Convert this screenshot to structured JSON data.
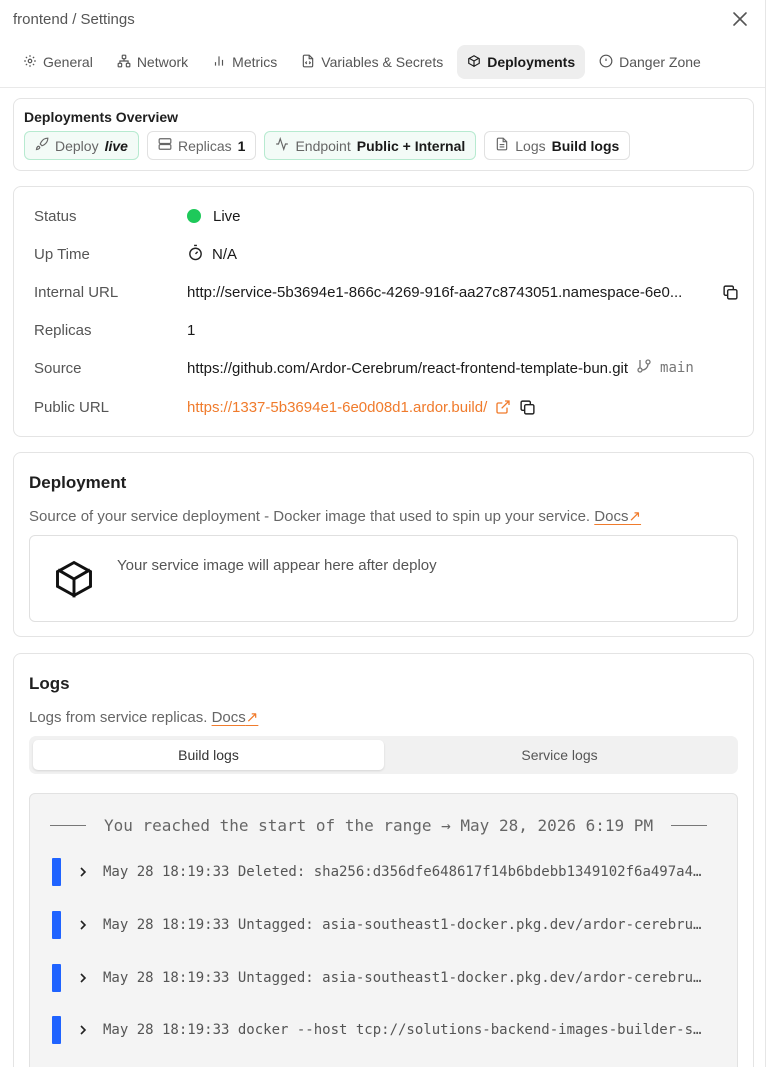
{
  "header": {
    "breadcrumb": "frontend / Settings"
  },
  "tabs": [
    {
      "label": "General",
      "icon": "gear-icon"
    },
    {
      "label": "Network",
      "icon": "network-icon"
    },
    {
      "label": "Metrics",
      "icon": "bar-chart-icon"
    },
    {
      "label": "Variables & Secrets",
      "icon": "file-code-icon"
    },
    {
      "label": "Deployments",
      "icon": "package-icon",
      "active": true
    },
    {
      "label": "Danger Zone",
      "icon": "alert-circle-icon"
    }
  ],
  "overview": {
    "title": "Deployments Overview",
    "pills": [
      {
        "label": "Deploy",
        "value": "live",
        "icon": "rocket-icon"
      },
      {
        "label": "Replicas",
        "value": "1",
        "icon": "server-icon"
      },
      {
        "label": "Endpoint",
        "value": "Public + Internal",
        "icon": "activity-icon"
      },
      {
        "label": "Logs",
        "value": "Build logs",
        "icon": "file-text-icon"
      }
    ]
  },
  "info": {
    "status_label": "Status",
    "status_value": "Live",
    "uptime_label": "Up Time",
    "uptime_value": "N/A",
    "internal_label": "Internal URL",
    "internal_value": "http://service-5b3694e1-866c-4269-916f-aa27c8743051.namespace-6e0...",
    "replicas_label": "Replicas",
    "replicas_value": "1",
    "source_label": "Source",
    "source_value": "https://github.com/Ardor-Cerebrum/react-frontend-template-bun.git",
    "source_branch": "main",
    "public_label": "Public URL",
    "public_value": "https://1337-5b3694e1-6e0d08d1.ardor.build/"
  },
  "deployment": {
    "title": "Deployment",
    "description": "Source of your service deployment - Docker image that used to spin up your service.",
    "docs": "Docs",
    "docs_arrow": "↗",
    "placeholder": "Your service image will appear here after deploy"
  },
  "logs": {
    "title": "Logs",
    "description": "Logs from service replicas.",
    "docs": "Docs",
    "docs_arrow": "↗",
    "tab_build": "Build logs",
    "tab_service": "Service logs",
    "range_text": "You reached the start of the range → May 28, 2026 6:19 PM",
    "rows": [
      "May 28 18:19:33 Deleted: sha256:d356dfe648617f14b6bdebb1349102f6a497a4…",
      "May 28 18:19:33 Untagged: asia-southeast1-docker.pkg.dev/ardor-cerebru…",
      "May 28 18:19:33 Untagged: asia-southeast1-docker.pkg.dev/ardor-cerebru…",
      "May 28 18:19:33 docker --host tcp://solutions-backend-images-builder-s…"
    ]
  },
  "colors": {
    "accent": "#f07b2c",
    "live": "#1ec95a",
    "log_bar": "#1f63ff"
  }
}
